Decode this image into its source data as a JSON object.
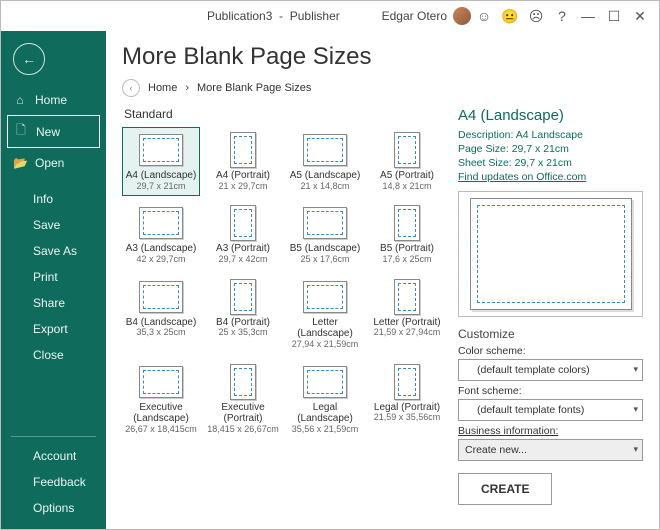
{
  "titlebar": {
    "doc": "Publication3",
    "app": "Publisher",
    "user": "Edgar Otero"
  },
  "sidebar": {
    "top": [
      {
        "icon": "⌂",
        "label": "Home"
      },
      {
        "icon": "🗋",
        "label": "New"
      },
      {
        "icon": "📂",
        "label": "Open"
      }
    ],
    "mid": [
      "Info",
      "Save",
      "Save As",
      "Print",
      "Share",
      "Export",
      "Close"
    ],
    "bottom": [
      "Account",
      "Feedback",
      "Options"
    ]
  },
  "heading": "More Blank Page Sizes",
  "breadcrumbs": {
    "home": "Home",
    "sep": "›",
    "current": "More Blank Page Sizes"
  },
  "section": "Standard",
  "templates": [
    {
      "name": "A4 (Landscape)",
      "dim": "29,7 x 21cm",
      "o": "l",
      "sel": true
    },
    {
      "name": "A4 (Portrait)",
      "dim": "21 x 29,7cm",
      "o": "p"
    },
    {
      "name": "A5 (Landscape)",
      "dim": "21 x 14,8cm",
      "o": "l"
    },
    {
      "name": "A5 (Portrait)",
      "dim": "14,8 x 21cm",
      "o": "p"
    },
    {
      "name": "A3 (Landscape)",
      "dim": "42 x 29,7cm",
      "o": "l"
    },
    {
      "name": "A3 (Portrait)",
      "dim": "29,7 x 42cm",
      "o": "p"
    },
    {
      "name": "B5 (Landscape)",
      "dim": "25 x 17,6cm",
      "o": "l"
    },
    {
      "name": "B5 (Portrait)",
      "dim": "17,6 x 25cm",
      "o": "p"
    },
    {
      "name": "B4 (Landscape)",
      "dim": "35,3 x 25cm",
      "o": "l"
    },
    {
      "name": "B4 (Portrait)",
      "dim": "25 x 35,3cm",
      "o": "p"
    },
    {
      "name": "Letter (Landscape)",
      "dim": "27,94 x 21,59cm",
      "o": "l"
    },
    {
      "name": "Letter (Portrait)",
      "dim": "21,59 x 27,94cm",
      "o": "p"
    },
    {
      "name": "Executive (Landscape)",
      "dim": "26,67 x 18,415cm",
      "o": "l"
    },
    {
      "name": "Executive (Portrait)",
      "dim": "18,415 x 26,67cm",
      "o": "p"
    },
    {
      "name": "Legal (Landscape)",
      "dim": "35,56 x 21,59cm",
      "o": "l"
    },
    {
      "name": "Legal (Portrait)",
      "dim": "21,59 x 35,56cm",
      "o": "p"
    }
  ],
  "right": {
    "title": "A4 (Landscape)",
    "desc": "Description: A4 Landscape",
    "pagesize": "Page Size: 29,7 x 21cm",
    "sheetsize": "Sheet Size: 29,7 x 21cm",
    "link": "Find updates on Office.com",
    "customize": "Customize",
    "color_label": "Color scheme:",
    "color_value": "(default template colors)",
    "font_label": "Font scheme:",
    "font_value": "(default template fonts)",
    "biz_label": "Business information:",
    "biz_value": "Create new...",
    "create": "CREATE"
  }
}
